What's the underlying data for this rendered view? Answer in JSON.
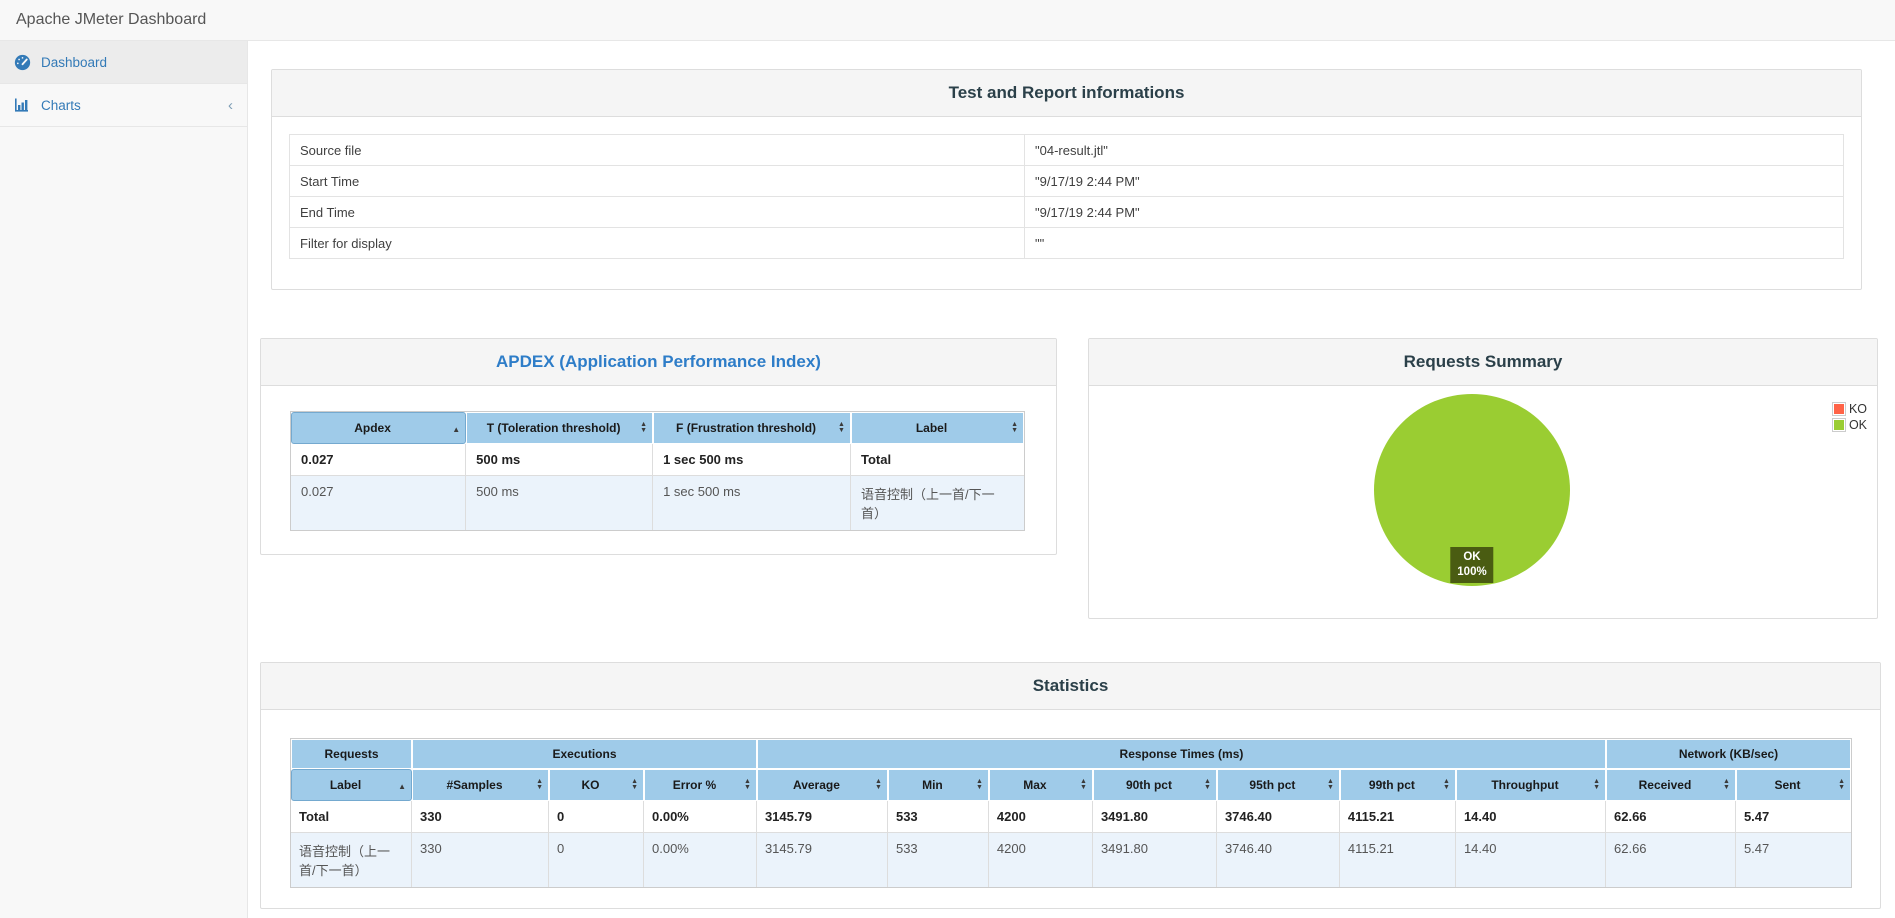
{
  "app": {
    "title": "Apache JMeter Dashboard"
  },
  "sidebar": {
    "items": [
      {
        "label": "Dashboard",
        "active": true
      },
      {
        "label": "Charts",
        "active": false,
        "collapse_icon": "chevron-left"
      }
    ]
  },
  "info_panel": {
    "title": "Test and Report informations",
    "rows": [
      {
        "label": "Source file",
        "value": "\"04-result.jtl\""
      },
      {
        "label": "Start Time",
        "value": "\"9/17/19 2:44 PM\""
      },
      {
        "label": "End Time",
        "value": "\"9/17/19 2:44 PM\""
      },
      {
        "label": "Filter for display",
        "value": "\"\""
      }
    ]
  },
  "apdex_panel": {
    "title": "APDEX (Application Performance Index)",
    "columns": [
      "Apdex",
      "T (Toleration threshold)",
      "F (Frustration threshold)",
      "Label"
    ],
    "sort": {
      "column": "Apdex",
      "direction": "asc"
    },
    "rows": [
      [
        "0.027",
        "500 ms",
        "1 sec 500 ms",
        "Total"
      ],
      [
        "0.027",
        "500 ms",
        "1 sec 500 ms",
        "语音控制（上一首/下一首）"
      ]
    ]
  },
  "requests_panel": {
    "title": "Requests Summary",
    "chart_data": {
      "type": "pie",
      "slices": [
        {
          "label": "KO",
          "value": 0,
          "color": "#ff6347"
        },
        {
          "label": "OK",
          "value": 100,
          "color": "#9acd32"
        }
      ],
      "legend": [
        {
          "label": "KO",
          "color": "#ff6347"
        },
        {
          "label": "OK",
          "color": "#9acd32"
        }
      ],
      "legend_position": "top-right",
      "data_label": {
        "line1": "OK",
        "line2": "100%"
      }
    }
  },
  "stats_panel": {
    "title": "Statistics",
    "groups": [
      {
        "label": "Requests",
        "span": 1
      },
      {
        "label": "Executions",
        "span": 3
      },
      {
        "label": "Response Times (ms)",
        "span": 7
      },
      {
        "label": "Network (KB/sec)",
        "span": 2
      }
    ],
    "columns": [
      "Label",
      "#Samples",
      "KO",
      "Error %",
      "Average",
      "Min",
      "Max",
      "90th pct",
      "95th pct",
      "99th pct",
      "Throughput",
      "Received",
      "Sent"
    ],
    "sort": {
      "column": "Label",
      "direction": "asc"
    },
    "rows": [
      [
        "Total",
        "330",
        "0",
        "0.00%",
        "3145.79",
        "533",
        "4200",
        "3491.80",
        "3746.40",
        "4115.21",
        "14.40",
        "62.66",
        "5.47"
      ],
      [
        "语音控制（上一首/下一首）",
        "330",
        "0",
        "0.00%",
        "3145.79",
        "533",
        "4200",
        "3491.80",
        "3746.40",
        "4115.21",
        "14.40",
        "62.66",
        "5.47"
      ]
    ]
  },
  "colors": {
    "link_blue": "#337ab7",
    "title_dark": "#2b4049",
    "title_blue": "#2e7dc8",
    "table_header_blue": "#9fcbe9",
    "row_alt_blue": "#ebf3fb",
    "pie_ok_green": "#9acd32",
    "pie_ko_red": "#ff6347",
    "pie_label_bg": "#4a5c12",
    "panel_heading_bg": "#f5f5f5"
  }
}
